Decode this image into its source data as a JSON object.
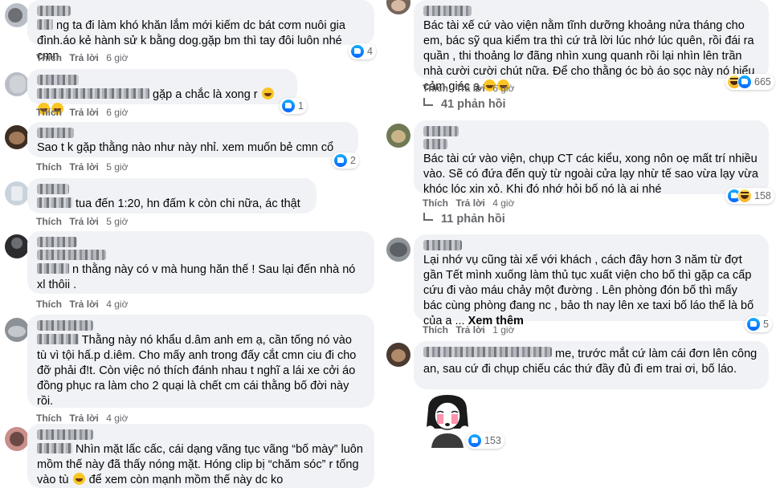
{
  "actions": {
    "like": "Thích",
    "reply": "Trả lời"
  },
  "left_comments": [
    {
      "text": "ng ta đi làm khó khăn lắm mới kiếm dc bát cơm nuôi gia đình.áo kẻ hành sử k bằng dog.gặp bm thì tay đôi luôn nhé cmn.",
      "time": "6 giờ",
      "reactions": "4"
    },
    {
      "text": "gặp a chắc là xong r",
      "time": "6 giờ",
      "reactions": "1"
    },
    {
      "text": "Sao t k gặp thằng nào như này nhỉ. xem muốn bẻ cmn cổ",
      "time": "5 giờ",
      "reactions": "2"
    },
    {
      "text": "tua đến 1:20, hn đấm k còn chi nữa, ác thật",
      "time": "5 giờ",
      "reactions": ""
    },
    {
      "text": "n thằng này có v mà hung hăn thế ! Sau lại đến nhà nó xl thôii .",
      "time": "4 giờ",
      "reactions": ""
    },
    {
      "text": "Thằng này nó khẩu d.âm anh em ạ, cần tống nó vào tù vì tội hấ.p d.iêm. Cho mấy anh trong đấy cắt cmn ciu đi cho đỡ phải đ!t. Còn việc nó thích đánh nhau t nghĩ a lái xe cởi áo đồng phục ra làm cho 2 quại là chết cm cái thằng bố đời này rồi.",
      "time": "4 giờ",
      "reactions": ""
    },
    {
      "text": "Nhìn mặt lấc cấc, cái dạng vãng tục vãng “bố mày” luôn mồm thế này đã thấy nóng mặt. Hóng clip bị “chăm sóc” r tống vào tù",
      "text_end": "để xem còn mạnh mồm thế này dc ko",
      "time": "",
      "reactions": ""
    }
  ],
  "right_comments": [
    {
      "text": "Bác tài xế cứ vào viện nằm tĩnh dưỡng khoảng nửa tháng cho em, bác sỹ qua kiểm tra thì cứ trả lời lúc nhớ lúc quên, rồi đái ra quần , thi thoảng lơ đãng nhìn xung quanh rồi lại nhìn lên trần nhà cười cười chút nữa. Để cho thằng óc bò áo sọc này nó hiểu cảm giác ạ",
      "time": "6 giờ",
      "reactions": "665",
      "replies": "41 phản hồi"
    },
    {
      "text": "Bác tài cứ vào viện, chụp CT các kiểu, xong nôn oẹ mất trí nhiều vào. Sẽ có đứa đến quỳ từ ngoài cửa lạy nhừ tế sao vừa lạy vừa khóc lóc xin xỏ. Khi đó nhớ hỏi bố nó là ai nhé",
      "time": "4 giờ",
      "reactions": "158",
      "replies": "11 phản hồi"
    },
    {
      "text": "Lại nhớ vụ cũng tài xế với khách , cách đây hơn 3 năm từ đợt gần Tết mình xuống làm thủ tục xuất viện cho bố thì gặp ca cấp cứu đi vào máu chảy một đường . Lên phòng đón bố thì mấy bác cùng phòng đang nc , bảo th nay lên xe taxi bố láo thế là bố của a ...",
      "see_more": "Xem thêm",
      "time": "1 giờ",
      "reactions": "5"
    },
    {
      "text": "me, trước mắt cứ làm cái đơn lên công an, sau cứ đi chụp chiếu các thứ đầy đủ đi em trai ơi, bố láo.",
      "time": "",
      "reactions": "153"
    }
  ]
}
